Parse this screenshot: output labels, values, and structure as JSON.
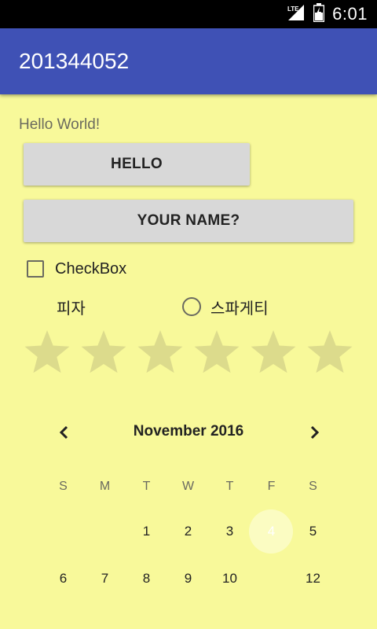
{
  "status_bar": {
    "network": "LTE",
    "time": "6:01"
  },
  "app_bar": {
    "title": "201344052"
  },
  "content": {
    "hello_text": "Hello World!",
    "hello_button": "HELLO",
    "name_button": "YOUR NAME?",
    "checkbox": {
      "label": "CheckBox",
      "checked": false
    },
    "radio_options": [
      {
        "label": "피자",
        "selected": false
      },
      {
        "label": "스파게티",
        "selected": false
      }
    ],
    "rating": {
      "stars": 6,
      "value": 0
    }
  },
  "calendar": {
    "month_label": "November 2016",
    "day_headers": [
      "S",
      "M",
      "T",
      "W",
      "T",
      "F",
      "S"
    ],
    "week1": [
      "",
      "",
      "1",
      "2",
      "3",
      "4",
      "5"
    ],
    "week2": [
      "6",
      "7",
      "8",
      "9",
      "10",
      "",
      "12"
    ],
    "selected_day": "4"
  },
  "colors": {
    "background": "#f8f99a",
    "app_bar": "#3f51b5",
    "star": "#dcdb8c"
  }
}
